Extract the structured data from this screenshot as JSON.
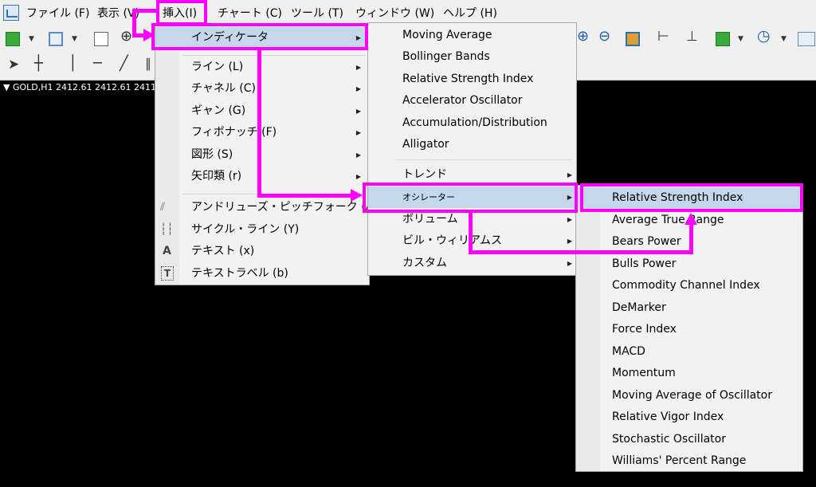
{
  "menubar": {
    "items": [
      "ファイル (F)",
      "表示 (V)",
      "挿入(I)",
      "チャート (C)",
      "ツール (T)",
      "ウィンドウ (W)",
      "ヘルプ (H)"
    ]
  },
  "chart": {
    "label": "GOLD,H1  2412.61 2412.61 2411"
  },
  "insert_menu": {
    "items": [
      "インディケータ",
      "ライン (L)",
      "チャネル (C)",
      "ギャン (G)",
      "フィボナッチ (F)",
      "図形 (S)",
      "矢印類 (r)",
      "アンドリューズ・ピッチフォーク (A)",
      "サイクル・ライン (Y)",
      "テキスト (x)",
      "テキストラベル (b)"
    ],
    "icon_letters": {
      "text": "A",
      "label": "T"
    }
  },
  "indicators_menu": {
    "items": [
      "Moving Average",
      "Bollinger Bands",
      "Relative Strength Index",
      "Accelerator Oscillator",
      "Accumulation/Distribution",
      "Alligator"
    ],
    "submenus": [
      "トレンド",
      "オシレーター",
      "ボリューム",
      "ビル・ウィリアムス",
      "カスタム"
    ]
  },
  "oscillators_menu": {
    "items": [
      "Relative Strength Index",
      "Average True Range",
      "Bears Power",
      "Bulls Power",
      "Commodity Channel Index",
      "DeMarker",
      "Force Index",
      "MACD",
      "Momentum",
      "Moving Average of Oscillator",
      "Relative Vigor Index",
      "Stochastic Oscillator",
      "Williams' Percent Range"
    ]
  },
  "colors": {
    "highlight": "#c5d7ea",
    "annotation": "#ff00ff",
    "menu_bg": "#f2f2f2"
  }
}
